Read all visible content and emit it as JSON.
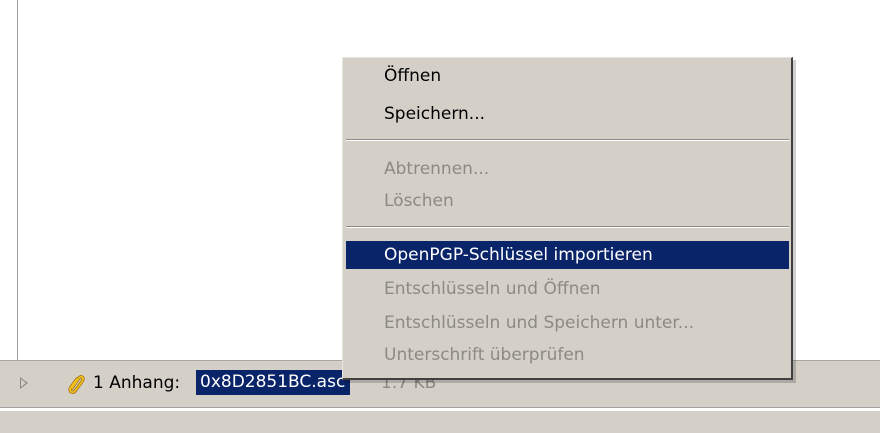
{
  "context_menu": {
    "items": [
      {
        "label": "Öffnen",
        "state": "enabled"
      },
      {
        "label": "Speichern...",
        "state": "enabled"
      },
      {
        "label": "Abtrennen...",
        "state": "disabled"
      },
      {
        "label": "Löschen",
        "state": "disabled"
      },
      {
        "label": "OpenPGP-Schlüssel importieren",
        "state": "highlighted"
      },
      {
        "label": "Entschlüsseln und Öffnen",
        "state": "disabled"
      },
      {
        "label": "Entschlüsseln und Speichern unter...",
        "state": "disabled"
      },
      {
        "label": "Unterschrift überprüfen",
        "state": "disabled"
      }
    ]
  },
  "attachment_bar": {
    "count_label": "1 Anhang:",
    "file_name": "0x8D2851BC.asc",
    "file_size": "1.7 KB"
  },
  "colors": {
    "menu_background": "#d4d0c8",
    "selection": "#0a246a",
    "disabled_text": "#8c8a84",
    "paperclip": "#e0a800"
  },
  "icons": {
    "expand": "triangle-right-icon",
    "attachment": "paperclip-icon"
  }
}
